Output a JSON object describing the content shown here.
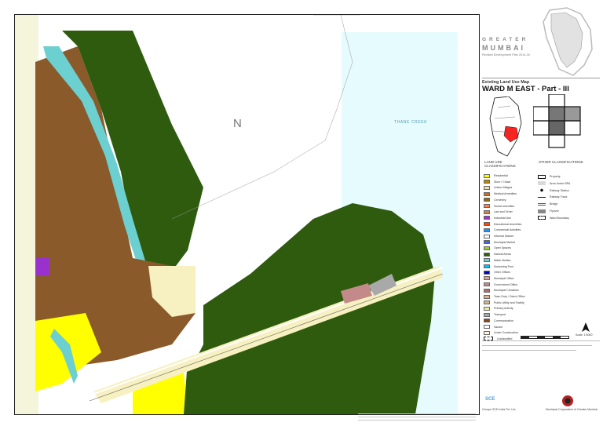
{
  "map": {
    "north_label": "N",
    "creek_label": "THANE CREEK"
  },
  "title": {
    "greater": "GREATER",
    "mumbai": "MUMBAI",
    "subtitle": "Revised Development Plan 2014-34",
    "map_type": "Existing Land Use Map",
    "ward": "WARD M EAST - Part - III"
  },
  "legend": {
    "land_use_heading": "LAND USE CLASSIFICATIONS",
    "other_heading": "OTHER CLASSIFICATIONS",
    "land_use_items": [
      {
        "label": "Residential",
        "color": "#ffff00"
      },
      {
        "label": "Slum / Chawl",
        "color": "#b8860b"
      },
      {
        "label": "Urban Villages",
        "color": "#f5deb3"
      },
      {
        "label": "Medical Amenities",
        "color": "#d2691e"
      },
      {
        "label": "Cemetery",
        "color": "#8b6914"
      },
      {
        "label": "Social amenities",
        "color": "#ff7f50"
      },
      {
        "label": "Law and Order",
        "color": "#cd853f"
      },
      {
        "label": "Industrial Use",
        "color": "#9932cc"
      },
      {
        "label": "Educational Amenities",
        "color": "#ff4500"
      },
      {
        "label": "Commercial Activities",
        "color": "#1e90ff"
      },
      {
        "label": "Informal Market",
        "color": "#ffffff"
      },
      {
        "label": "Municipal Market",
        "color": "#4169e1"
      },
      {
        "label": "Open Spaces",
        "color": "#9acd32"
      },
      {
        "label": "Natural Areas",
        "color": "#2f5e0a"
      },
      {
        "label": "Water Bodies",
        "color": "#6ccfd0"
      },
      {
        "label": "Swimming Pool",
        "color": "#00bfff"
      },
      {
        "label": "Other Offices",
        "color": "#0000cd"
      },
      {
        "label": "Municipal Office",
        "color": "#d8a0a0"
      },
      {
        "label": "Government Office",
        "color": "#c48a8a"
      },
      {
        "label": "Municipal Chowkies",
        "color": "#b07070"
      },
      {
        "label": "Town Duty / Octroi Office",
        "color": "#e0b090"
      },
      {
        "label": "Public Utility and Facility",
        "color": "#d2b48c"
      },
      {
        "label": "Primary Activity",
        "color": "#eee8aa"
      },
      {
        "label": "Transport",
        "color": "#a9a9a9"
      },
      {
        "label": "Communication",
        "color": "#8b4513"
      },
      {
        "label": "Vacant",
        "color": "#ffffff"
      },
      {
        "label": "Under Construction",
        "color": "#fff8dc"
      },
      {
        "label": "Unclassified",
        "color": "#ffffff"
      }
    ],
    "other_items": [
      {
        "label": "Property",
        "symbol": "box"
      },
      {
        "label": "Area Under BPA",
        "symbol": "grey"
      },
      {
        "label": "Railway Station",
        "symbol": "dot"
      },
      {
        "label": "Railway Track",
        "symbol": "line"
      },
      {
        "label": "Bridge",
        "symbol": "bridge"
      },
      {
        "label": "Flyover",
        "symbol": "flyover"
      },
      {
        "label": "Ward Boundary",
        "symbol": "dashed"
      }
    ]
  },
  "scale": {
    "label": "Scale: 1:5000"
  },
  "footer": {
    "consultant": "Groupe SCE India Pvt. Ltd.",
    "consultant_logo": "SCE",
    "client": "Municipal Corporation of Greater Mumbai"
  },
  "colors": {
    "natural": "#2e5b0d",
    "slum": "#8b5a2b",
    "water": "#6ccfd0",
    "creek": "#e6fbfd",
    "residential": "#ffff00",
    "urban_village": "#f7f0c0",
    "industrial": "#9932cc"
  }
}
